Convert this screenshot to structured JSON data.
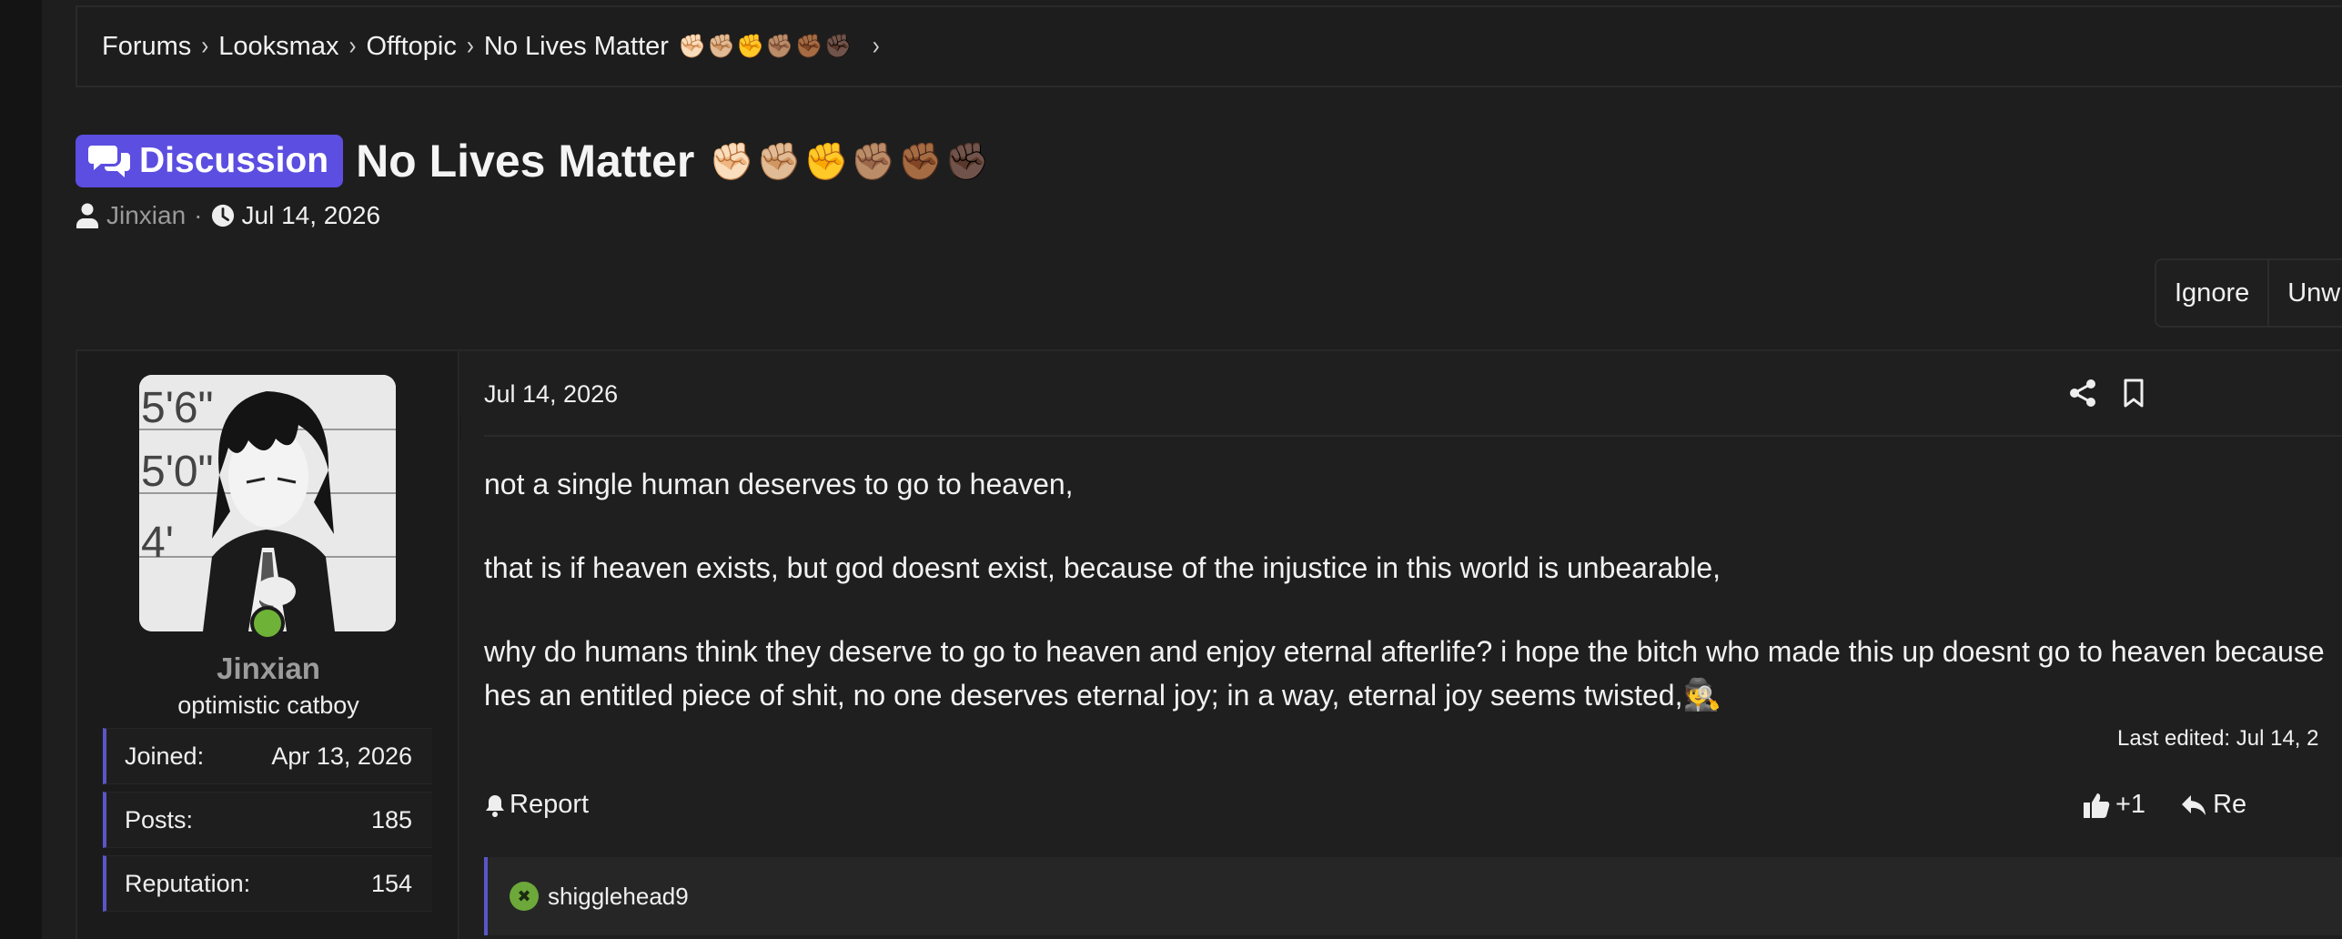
{
  "breadcrumb": {
    "items": [
      "Forums",
      "Looksmax",
      "Offtopic",
      "No Lives Matter"
    ],
    "fists": "✊🏻✊🏼✊✊🏽✊🏾✊🏿"
  },
  "thread": {
    "prefix": "Discussion",
    "title": "No Lives Matter",
    "title_fists": "✊🏻✊🏼✊✊🏽✊🏾✊🏿",
    "author": "Jinxian",
    "separator": "·",
    "date": "Jul 14, 2026"
  },
  "actions": {
    "ignore": "Ignore",
    "unwatch": "Unw"
  },
  "user": {
    "name": "Jinxian",
    "title": "optimistic catboy",
    "stats": [
      {
        "label": "Joined:",
        "value": "Apr 13, 2026"
      },
      {
        "label": "Posts:",
        "value": "185"
      },
      {
        "label": "Reputation:",
        "value": "154"
      }
    ],
    "avatar_ruler": [
      "5'6\"",
      "5'0\"",
      "4'"
    ]
  },
  "post": {
    "date": "Jul 14, 2026",
    "paragraphs": [
      "not a single human deserves to go to heaven,",
      "that is if heaven exists, but god doesnt exist, because of the injustice in this world is unbearable,",
      "why do humans think they deserve to go to heaven and enjoy eternal afterlife? i hope the bitch who made this up doesnt go to heaven because hes an entitled piece of shit, no one deserves eternal joy; in a way, eternal joy seems twisted,"
    ],
    "last_edited": "Last edited: Jul 14, 2",
    "report": "Report",
    "reaction_count": "+1",
    "reply": "Re",
    "reacted_user": "shigglehead9"
  },
  "colors": {
    "accent": "#5c4ee0",
    "online": "#6fb238",
    "stat_border": "#5a56c8"
  }
}
